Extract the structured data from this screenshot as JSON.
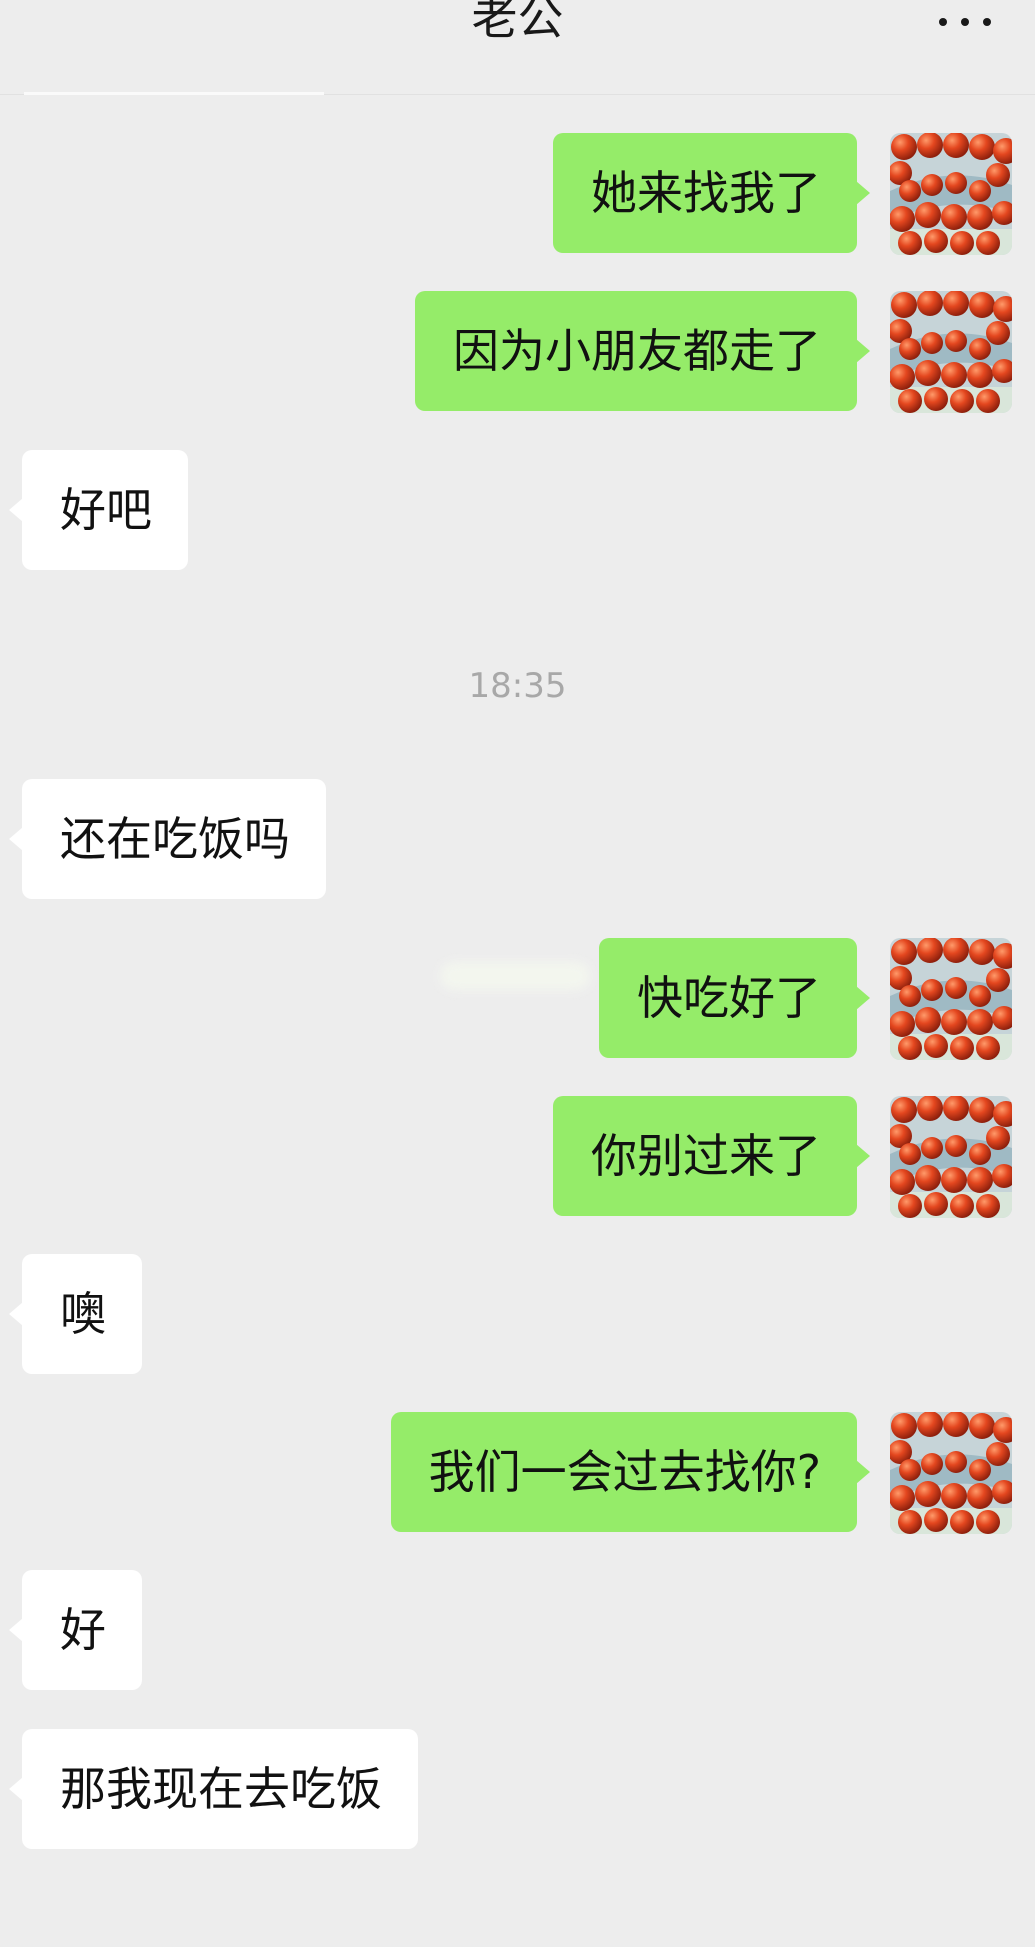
{
  "header": {
    "title": "老公"
  },
  "timestamp": "18:35",
  "messages": [
    {
      "text": "她来找我了",
      "side": "out"
    },
    {
      "text": "因为小朋友都走了",
      "side": "out"
    },
    {
      "text": "好吧",
      "side": "in"
    },
    {
      "text": "还在吃饭吗",
      "side": "in"
    },
    {
      "text": "快吃好了",
      "side": "out"
    },
    {
      "text": "你别过来了",
      "side": "out"
    },
    {
      "text": "噢",
      "side": "in"
    },
    {
      "text": "我们一会过去找你?",
      "side": "out"
    },
    {
      "text": "好",
      "side": "in"
    },
    {
      "text": "那我现在去吃饭",
      "side": "in"
    }
  ],
  "colors": {
    "background": "#ededed",
    "outgoing_bubble": "#95ec69",
    "incoming_bubble": "#ffffff",
    "timestamp_text": "#a8a8a8"
  },
  "icons": {
    "more": "more-dots-icon",
    "avatar": "bead-bracelet-avatar"
  }
}
